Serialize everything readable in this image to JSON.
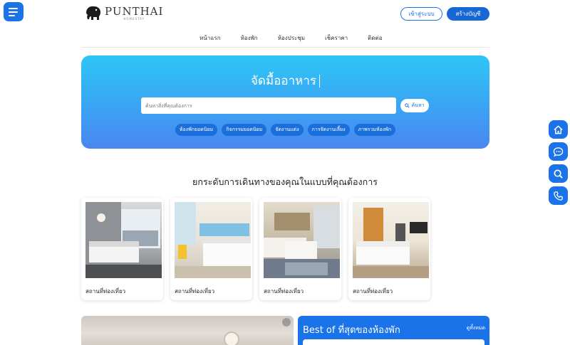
{
  "header": {
    "logo_name": "PUNTHAI",
    "logo_sub": "HOMESTAY",
    "login_label": "เข้าสู่ระบบ",
    "register_label": "สร้างบัญชี"
  },
  "nav": {
    "items": [
      "หน้าแรก",
      "ห้องพัก",
      "ห้องประชุม",
      "เช็คราคา",
      "ติดต่อ"
    ]
  },
  "hero": {
    "title": "จัดมื้ออาหาร",
    "search_placeholder": "ค้นหาสิ่งที่คุณต้องการ",
    "search_button": "ค้นหา",
    "chips": [
      "ห้องพักยอดนิยม",
      "กิจกรรมยอดนิยม",
      "จัดงานแต่ง",
      "การจัดงานเลี้ยง",
      "ภาพรวมห้องพัก"
    ]
  },
  "section": {
    "title": "ยกระดับการเดินทางของคุณในแบบที่คุณต้องการ"
  },
  "cards": [
    {
      "label": "สถานที่ท่องเที่ยว"
    },
    {
      "label": "สถานที่ท่องเที่ยว"
    },
    {
      "label": "สถานที่ท่องเที่ยว"
    },
    {
      "label": "สถานที่ท่องเที่ยว"
    }
  ],
  "best": {
    "title": "Best of ที่สุดของห้องพัก",
    "see_all": "ดูทั้งหมด"
  },
  "side_icons": [
    "home-icon",
    "chat-icon",
    "search-icon",
    "phone-icon"
  ],
  "colors": {
    "primary": "#1a73e8",
    "hero_top": "#2ec6f6",
    "hero_bottom": "#4a86f0"
  }
}
